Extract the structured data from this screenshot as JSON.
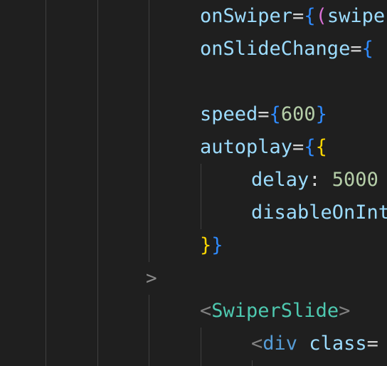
{
  "colors": {
    "background": "#1f1f1f",
    "guide": "#404040",
    "attribute": "#9cdcfe",
    "operator": "#d4d4d4",
    "brace_outer": "#2f8bff",
    "brace_inner": "#ffd700",
    "paren": "#da70d6",
    "number": "#b5cea8",
    "tag": "#4ec9b0",
    "html_tag": "#569cd6",
    "angle": "#808080"
  },
  "gutter": {
    "fold_marker_icon": "chevron-right-icon",
    "fold_marker": ">"
  },
  "lines": [
    {
      "tokens": [
        {
          "text": "onSwiper",
          "kind": "attribute"
        },
        {
          "text": "=",
          "kind": "operator"
        },
        {
          "text": "{",
          "kind": "brace_outer"
        },
        {
          "text": "(",
          "kind": "paren"
        },
        {
          "text": "swipe",
          "kind": "attribute"
        }
      ]
    },
    {
      "tokens": [
        {
          "text": "onSlideChange",
          "kind": "attribute"
        },
        {
          "text": "=",
          "kind": "operator"
        },
        {
          "text": "{",
          "kind": "brace_outer"
        }
      ]
    },
    {
      "tokens": []
    },
    {
      "tokens": [
        {
          "text": "speed",
          "kind": "attribute"
        },
        {
          "text": "=",
          "kind": "operator"
        },
        {
          "text": "{",
          "kind": "brace_outer"
        },
        {
          "text": "600",
          "kind": "number"
        },
        {
          "text": "}",
          "kind": "brace_outer"
        }
      ]
    },
    {
      "tokens": [
        {
          "text": "autoplay",
          "kind": "attribute"
        },
        {
          "text": "=",
          "kind": "operator"
        },
        {
          "text": "{",
          "kind": "brace_outer"
        },
        {
          "text": "{",
          "kind": "brace_inner"
        }
      ]
    },
    {
      "tokens": [
        {
          "text": "delay",
          "kind": "attribute"
        },
        {
          "text": ": ",
          "kind": "operator"
        },
        {
          "text": "5000",
          "kind": "number"
        }
      ]
    },
    {
      "tokens": [
        {
          "text": "disableOnInt",
          "kind": "attribute"
        }
      ]
    },
    {
      "tokens": [
        {
          "text": "}",
          "kind": "brace_inner"
        },
        {
          "text": "}",
          "kind": "brace_outer"
        }
      ]
    },
    {
      "tokens": []
    },
    {
      "tokens": [
        {
          "text": "<",
          "kind": "angle"
        },
        {
          "text": "SwiperSlide",
          "kind": "tag"
        },
        {
          "text": ">",
          "kind": "angle"
        }
      ]
    },
    {
      "tokens": [
        {
          "text": "<",
          "kind": "angle"
        },
        {
          "text": "div",
          "kind": "html_tag"
        },
        {
          "text": " ",
          "kind": "operator"
        },
        {
          "text": "class",
          "kind": "attribute"
        },
        {
          "text": "=",
          "kind": "operator"
        }
      ]
    }
  ]
}
